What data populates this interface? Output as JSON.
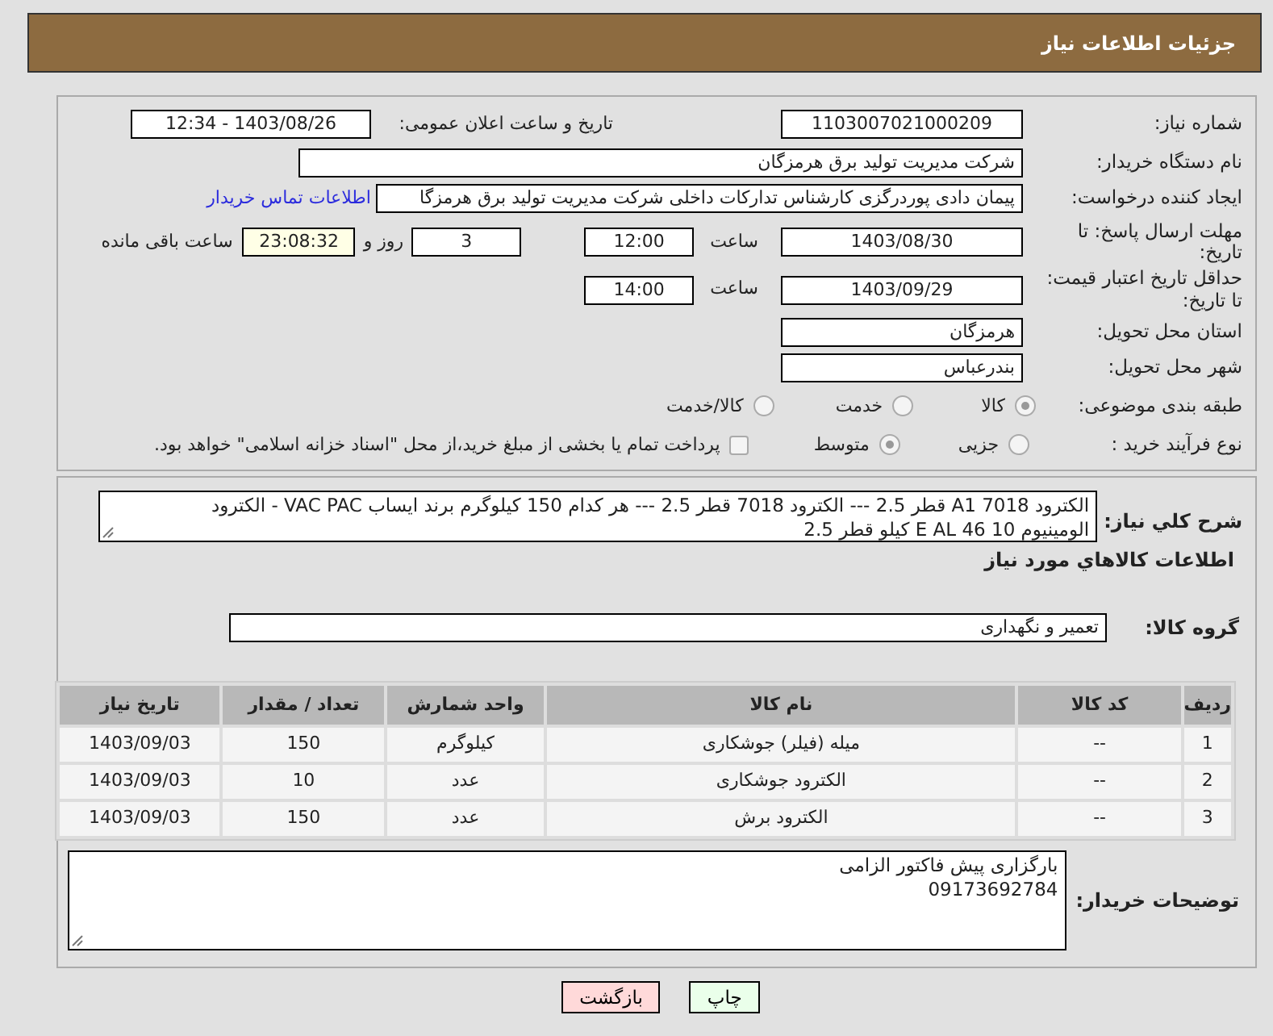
{
  "header": {
    "title": "جزئیات اطلاعات نیاز"
  },
  "need_number": {
    "label": "شماره نیاز:",
    "value": "1103007021000209"
  },
  "announce": {
    "label": "تاریخ و ساعت اعلان عمومی:",
    "value": "1403/08/26 - 12:34"
  },
  "buyer_org": {
    "label": "نام دستگاه خریدار:",
    "value": "شرکت مدیریت تولید برق هرمزگان"
  },
  "requester": {
    "label": "ایجاد کننده درخواست:",
    "value": "پیمان دادی پوردرگزی کارشناس تدارکات داخلی شرکت مدیریت تولید برق هرمزگا",
    "link": "اطلاعات تماس خریدار"
  },
  "reply_deadline": {
    "label": "مهلت ارسال پاسخ: تا تاریخ:",
    "date": "1403/08/30",
    "time_label": "ساعت",
    "time": "12:00",
    "days": "3",
    "days_label": "روز و",
    "remaining": "23:08:32",
    "remaining_label": "ساعت باقی مانده"
  },
  "price_validity": {
    "label": "حداقل تاریخ اعتبار قیمت: تا تاریخ:",
    "date": "1403/09/29",
    "time_label": "ساعت",
    "time": "14:00"
  },
  "province": {
    "label": "استان محل تحویل:",
    "value": "هرمزگان"
  },
  "city": {
    "label": "شهر محل تحویل:",
    "value": "بندرعباس"
  },
  "category": {
    "label": "طبقه بندی موضوعی:",
    "options": [
      {
        "label": "کالا",
        "selected": true
      },
      {
        "label": "خدمت",
        "selected": false
      },
      {
        "label": "کالا/خدمت",
        "selected": false
      }
    ]
  },
  "process": {
    "label": "نوع فرآیند خرید :",
    "options": [
      {
        "label": "جزیی",
        "selected": false
      },
      {
        "label": "متوسط",
        "selected": true
      }
    ],
    "treasury": {
      "label": "پرداخت تمام یا بخشی از مبلغ خرید،از محل \"اسناد خزانه اسلامی\" خواهد بود.",
      "checked": false
    }
  },
  "description": {
    "label": "شرح کلي نياز:",
    "lines": [
      "الکترود 7018 A1 قطر 2.5 --- الکترود 7018  قطر 2.5 --- هر کدام 150 کیلوگرم برند ایساب VAC PAC - الکترود",
      "الومینیوم 10 E AL 46 کیلو قطر 2.5"
    ]
  },
  "goods_title": "اطلاعات کالاهاي مورد نياز",
  "goods_group": {
    "label": "گروه کالا:",
    "value": "تعمیر و نگهداری"
  },
  "table": {
    "columns": [
      "ردیف",
      "کد کالا",
      "نام کالا",
      "واحد شمارش",
      "تعداد / مقدار",
      "تاریخ نیاز"
    ],
    "rows": [
      [
        "1",
        "--",
        "میله (فیلر) جوشکاری",
        "کیلوگرم",
        "150",
        "1403/09/03"
      ],
      [
        "2",
        "--",
        "الکترود جوشکاری",
        "عدد",
        "10",
        "1403/09/03"
      ],
      [
        "3",
        "--",
        "الکترود برش",
        "عدد",
        "150",
        "1403/09/03"
      ]
    ]
  },
  "buyer_notes": {
    "label": "توضیحات خریدار:",
    "lines": [
      "بارگزاری پیش فاکتور الزامی",
      "09173692784"
    ]
  },
  "buttons": [
    {
      "label": "چاپ",
      "kind": "print"
    },
    {
      "label": "بازگشت",
      "kind": "back"
    }
  ]
}
